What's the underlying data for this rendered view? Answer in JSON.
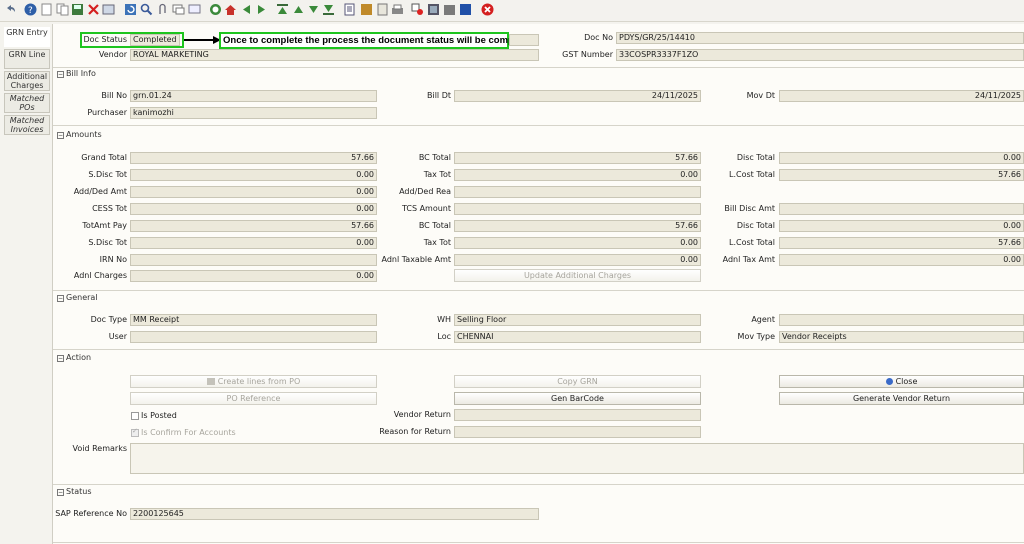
{
  "toolbar": {
    "icons": [
      "undo-icon",
      "help-icon",
      "new-icon",
      "copy-icon",
      "save-icon",
      "delete-icon",
      "print-preview-icon",
      "refresh-icon",
      "find-icon",
      "attachment-icon",
      "chat-icon",
      "history-icon",
      "home-icon",
      "previous-icon",
      "next-icon",
      "first-icon",
      "up-icon",
      "down-icon",
      "last-icon",
      "report-icon",
      "archive-icon",
      "zoom-icon",
      "print-icon",
      "request-icon",
      "product-icon",
      "workflow-icon",
      "window-icon",
      "close-window-icon"
    ]
  },
  "sidebar": {
    "items": [
      {
        "label": "GRN Entry"
      },
      {
        "label": "GRN Line"
      },
      {
        "label": "Additional Charges"
      },
      {
        "label": "Matched POs"
      },
      {
        "label": "Matched Invoices"
      }
    ]
  },
  "header": {
    "doc_status_label": "Doc Status",
    "doc_status_value": "Completed",
    "annotation": "Once to complete the process the document status will be completed",
    "doc_no_label": "Doc No",
    "doc_no_value": "PDYS/GR/25/14410",
    "vendor_label": "Vendor",
    "vendor_value": "ROYAL MARKETING",
    "gst_label": "GST Number",
    "gst_value": "33COSPR3337F1ZO"
  },
  "bill_info": {
    "title": "Bill Info",
    "bill_no_label": "Bill No",
    "bill_no_value": "grn.01.24",
    "bill_dt_label": "Bill Dt",
    "bill_dt_value": "24/11/2025",
    "mov_dt_label": "Mov Dt",
    "mov_dt_value": "24/11/2025",
    "purchaser_label": "Purchaser",
    "purchaser_value": "kanimozhi"
  },
  "amounts": {
    "title": "Amounts",
    "grand_total_label": "Grand Total",
    "grand_total_value": "57.66",
    "bc_total_label": "BC Total",
    "bc_total_value": "57.66",
    "disc_total_label": "Disc Total",
    "disc_total_value": "0.00",
    "s_disc_tot_label": "S.Disc Tot",
    "s_disc_tot_value": "0.00",
    "tax_tot_label": "Tax Tot",
    "tax_tot_value": "0.00",
    "lcost_total_label": "L.Cost Total",
    "lcost_total_value": "57.66",
    "add_ded_amt_label": "Add/Ded Amt",
    "add_ded_amt_value": "0.00",
    "add_ded_rea_label": "Add/Ded Rea",
    "add_ded_rea_value": "",
    "cess_tot_label": "CESS Tot",
    "cess_tot_value": "0.00",
    "tcs_amount_label": "TCS Amount",
    "tcs_amount_value": "",
    "bill_disc_amt_label": "Bill Disc Amt",
    "bill_disc_amt_value": "",
    "totamt_pay_label": "TotAmt Pay",
    "totamt_pay_value": "57.66",
    "bc_total2_label": "BC Total",
    "bc_total2_value": "57.66",
    "disc_total2_label": "Disc Total",
    "disc_total2_value": "0.00",
    "s_disc_tot2_label": "S.Disc Tot",
    "s_disc_tot2_value": "0.00",
    "tax_tot2_label": "Tax Tot",
    "tax_tot2_value": "0.00",
    "lcost_total2_label": "L.Cost Total",
    "lcost_total2_value": "57.66",
    "irn_no_label": "IRN No",
    "irn_no_value": "",
    "adnl_taxable_label": "Adnl Taxable Amt",
    "adnl_taxable_value": "0.00",
    "adnl_tax_label": "Adnl Tax Amt",
    "adnl_tax_value": "0.00",
    "adnl_charges_label": "Adnl Charges",
    "adnl_charges_value": "0.00",
    "update_btn": "Update Additional Charges"
  },
  "general": {
    "title": "General",
    "doc_type_label": "Doc Type",
    "doc_type_value": "MM Receipt",
    "wh_label": "WH",
    "wh_value": "Selling Floor",
    "agent_label": "Agent",
    "agent_value": "",
    "user_label": "User",
    "user_value": "",
    "loc_label": "Loc",
    "loc_value": "CHENNAI",
    "mov_type_label": "Mov Type",
    "mov_type_value": "Vendor Receipts"
  },
  "action": {
    "title": "Action",
    "create_lines_btn": "Create lines from PO",
    "copy_grn_btn": "Copy GRN",
    "close_btn": "Close",
    "po_ref_btn": "PO Reference",
    "gen_barcode_btn": "Gen BarCode",
    "gen_vendor_return_btn": "Generate Vendor Return",
    "is_posted_label": "Is Posted",
    "vendor_return_label": "Vendor Return",
    "vendor_return_value": "",
    "is_confirm_label": "Is Confirm For Accounts",
    "reason_label": "Reason for Return",
    "reason_value": "",
    "void_remarks_label": "Void Remarks",
    "void_remarks_value": ""
  },
  "status": {
    "title": "Status",
    "sap_ref_label": "SAP Reference No",
    "sap_ref_value": "2200125645"
  },
  "colors": {
    "field_bg": "#ece9db",
    "highlight_green": "#1ec51e",
    "close_btn_icon": "#3a6ac8",
    "delete_red": "#d42020"
  }
}
